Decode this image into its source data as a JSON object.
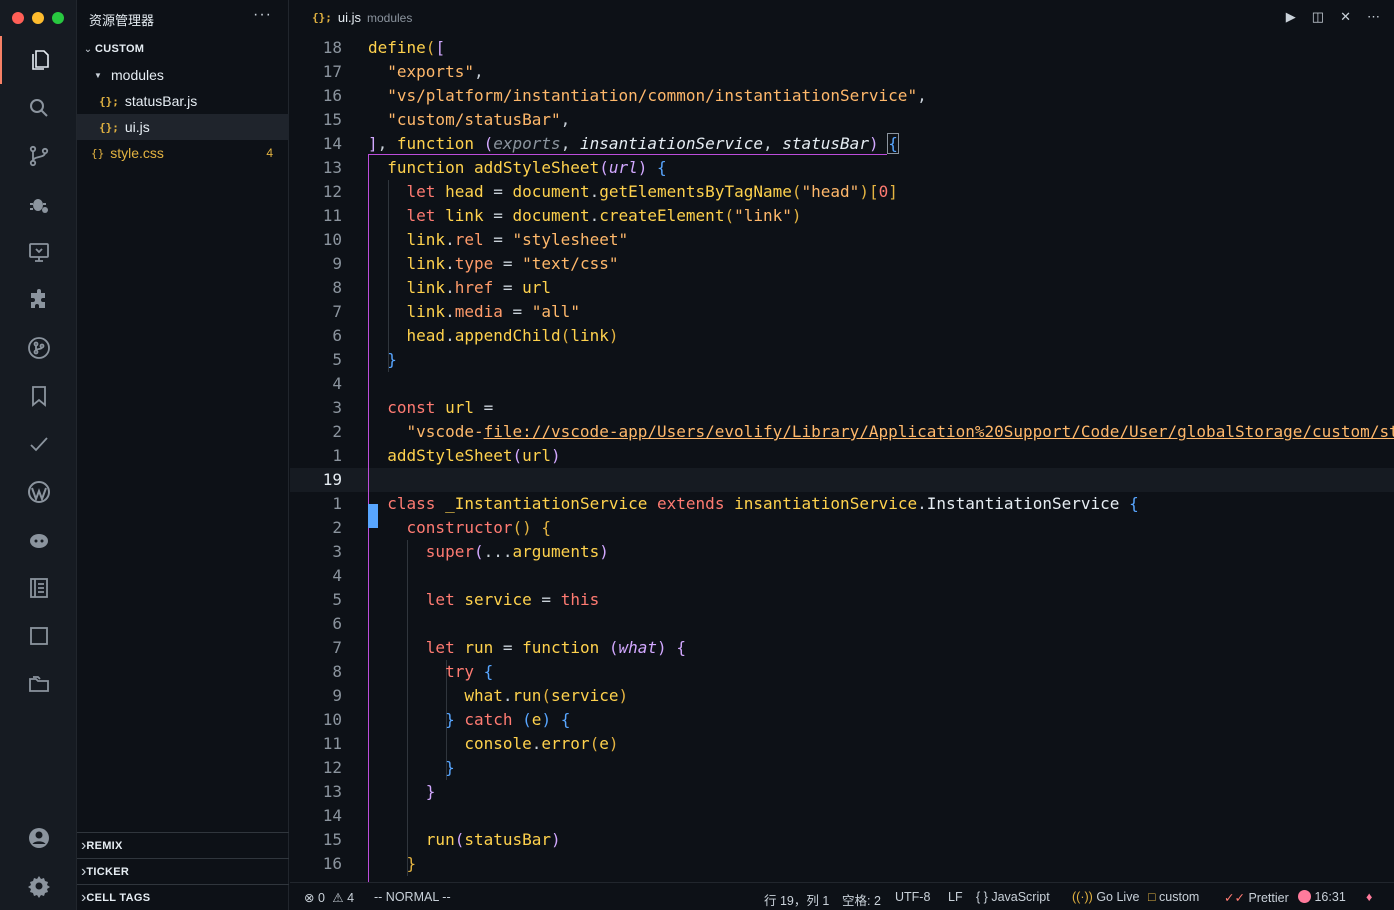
{
  "colors": {
    "red": "#ff5f57",
    "yellow": "#febc2e",
    "green": "#28c840",
    "accent": "#f78166",
    "cursor": "#58a6ff"
  },
  "activity_icons": [
    "explorer-icon",
    "search-icon",
    "source-control-icon",
    "debug-icon",
    "remote-explorer-icon",
    "extensions-icon",
    "git-graph-icon",
    "bookmark-icon",
    "todo-check-icon",
    "wordpress-icon",
    "copilot-icon",
    "notebook-icon",
    "square-icon",
    "folders-icon",
    "account-icon",
    "settings-gear-icon"
  ],
  "sidebar": {
    "title": "资源管理器",
    "more": "···",
    "section": "CUSTOM",
    "folder": "modules",
    "files": [
      {
        "icon": "{};",
        "name": "statusBar.js"
      },
      {
        "icon": "{};",
        "name": "ui.js"
      }
    ],
    "css_file": {
      "icon": "{}",
      "name": "style.css",
      "count": "4"
    },
    "bottom_sections": [
      "REMIX",
      "TICKER",
      "CELL TAGS"
    ]
  },
  "tab": {
    "icon": "{};",
    "file": "ui.js",
    "folder": "modules"
  },
  "status": {
    "errors": "0",
    "warnings": "4",
    "mode": "-- NORMAL --",
    "position": "行 19，列 1",
    "spaces": "空格: 2",
    "encoding": "UTF-8",
    "eol": "LF",
    "language": "JavaScript",
    "golive": "Go Live",
    "folder": "custom",
    "prettier": "Prettier",
    "time": "16:31"
  },
  "editor": {
    "line_numbers": [
      "18",
      "17",
      "16",
      "15",
      "14",
      "13",
      "12",
      "11",
      "10",
      "9",
      "8",
      "7",
      "6",
      "5",
      "4",
      "3",
      "2",
      "1",
      "19",
      "1",
      "2",
      "3",
      "4",
      "5",
      "6",
      "7",
      "8",
      "9",
      "10",
      "11",
      "12",
      "13",
      "14",
      "15",
      "16"
    ],
    "current_index": 18
  }
}
